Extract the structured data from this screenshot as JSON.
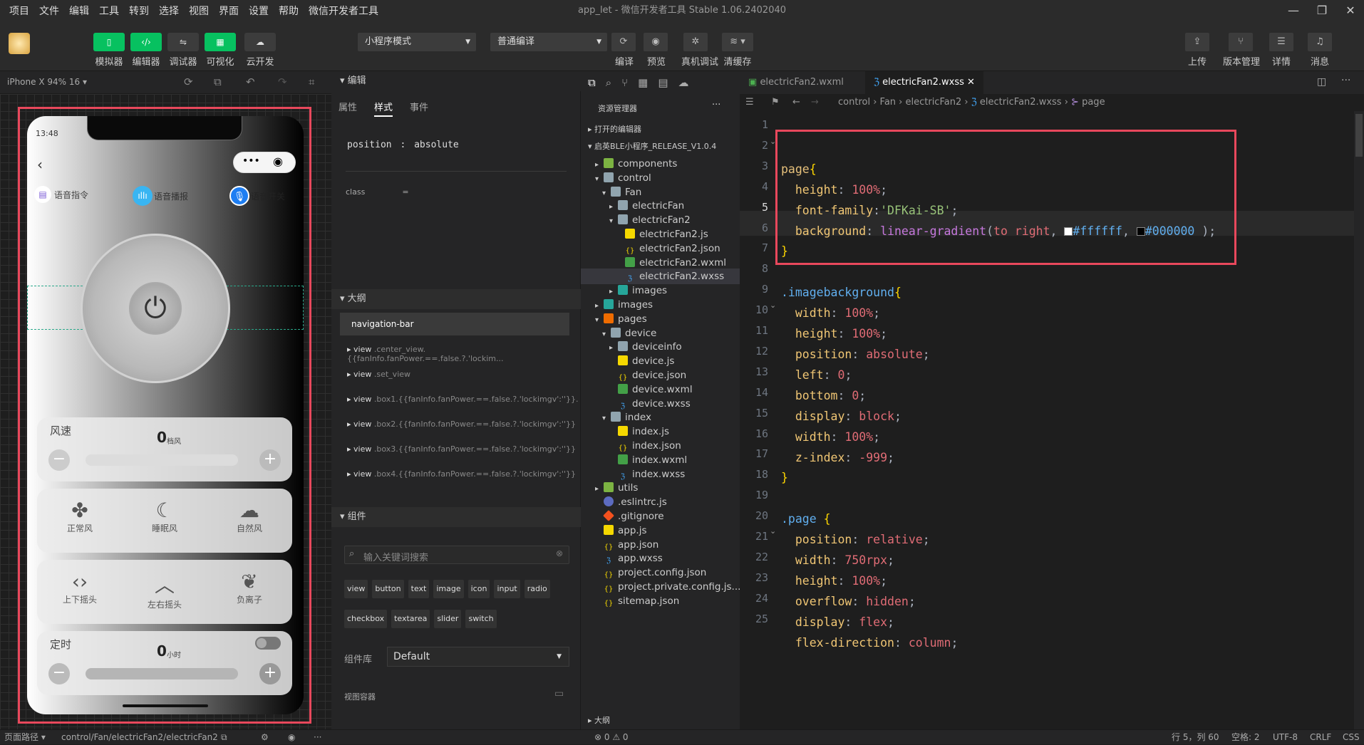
{
  "menu": [
    "项目",
    "文件",
    "编辑",
    "工具",
    "转到",
    "选择",
    "视图",
    "界面",
    "设置",
    "帮助",
    "微信开发者工具"
  ],
  "window_title": "app_let - 微信开发者工具 Stable 1.06.2402040",
  "toolbar": {
    "mode_buttons": [
      "模拟器",
      "编辑器",
      "调试器",
      "可视化",
      "云开发"
    ],
    "mode_select": "小程序模式",
    "compile_select": "普通编译",
    "action_labels": [
      "编译",
      "预览",
      "真机调试",
      "清缓存"
    ],
    "right_labels": [
      "上传",
      "版本管理",
      "详情",
      "消息"
    ]
  },
  "simulator": {
    "device": "iPhone X 94% 16",
    "time": "13:48",
    "voice_buttons": [
      "语音指令",
      "语音播报",
      "语音开关"
    ],
    "speed_label": "风速",
    "speed_value": "0",
    "speed_unit": "档风",
    "modes": [
      "正常风",
      "睡眠风",
      "自然风"
    ],
    "swings": [
      "上下摇头",
      "左右摇头",
      "负离子"
    ],
    "timer_label": "定时",
    "timer_value": "0",
    "timer_unit": "小时"
  },
  "attr_panel": {
    "title": "编辑",
    "tabs": [
      "属性",
      "样式",
      "事件"
    ],
    "position_label": "position",
    "position_sep": ":",
    "position_value": "absolute",
    "class_label": "class",
    "class_sep": "=",
    "outline_title": "大纲",
    "outline_selected": "navigation-bar",
    "outline_items": [
      {
        "tag": "view",
        "cls": ".center_view.{{fanInfo.fanPower.==.false.?.'lockim..."
      },
      {
        "tag": "view",
        "cls": ".set_view"
      },
      {
        "tag": "view",
        "cls": ".box1.{{fanInfo.fanPower.==.false.?.'lockimgv':''}}."
      },
      {
        "tag": "view",
        "cls": ".box2.{{fanInfo.fanPower.==.false.?.'lockimgv':''}}"
      },
      {
        "tag": "view",
        "cls": ".box3.{{fanInfo.fanPower.==.false.?.'lockimgv':''}}"
      },
      {
        "tag": "view",
        "cls": ".box4.{{fanInfo.fanPower.==.false.?.'lockimgv':''}}"
      }
    ],
    "components_title": "组件",
    "search_placeholder": "输入关键词搜索",
    "chips_row1": [
      "view",
      "button",
      "text",
      "image",
      "icon",
      "input",
      "radio"
    ],
    "chips_row2": [
      "checkbox",
      "textarea",
      "slider",
      "switch"
    ],
    "lib_label": "组件库",
    "lib_value": "Default",
    "container_label": "视图容器"
  },
  "explorer": {
    "title": "资源管理器",
    "open_editors": "打开的编辑器",
    "project": "启英BLE小程序_RELEASE_V1.0.4",
    "outline": "大纲",
    "files": [
      {
        "name": "components",
        "level": 1,
        "type": "folder-green",
        "arrow": "▸"
      },
      {
        "name": "control",
        "level": 1,
        "type": "folder",
        "arrow": "▾"
      },
      {
        "name": "Fan",
        "level": 2,
        "type": "folder",
        "arrow": "▾"
      },
      {
        "name": "electricFan",
        "level": 3,
        "type": "folder",
        "arrow": "▸"
      },
      {
        "name": "electricFan2",
        "level": 3,
        "type": "folder",
        "arrow": "▾"
      },
      {
        "name": "electricFan2.js",
        "level": 4,
        "type": "js",
        "arrow": ""
      },
      {
        "name": "electricFan2.json",
        "level": 4,
        "type": "json",
        "arrow": ""
      },
      {
        "name": "electricFan2.wxml",
        "level": 4,
        "type": "wxml",
        "arrow": ""
      },
      {
        "name": "electricFan2.wxss",
        "level": 4,
        "type": "wxss",
        "arrow": "",
        "selected": true
      },
      {
        "name": "images",
        "level": 3,
        "type": "folder-img",
        "arrow": "▸"
      },
      {
        "name": "images",
        "level": 1,
        "type": "folder-img",
        "arrow": "▸"
      },
      {
        "name": "pages",
        "level": 1,
        "type": "folder-red",
        "arrow": "▾"
      },
      {
        "name": "device",
        "level": 2,
        "type": "folder",
        "arrow": "▾"
      },
      {
        "name": "deviceinfo",
        "level": 3,
        "type": "folder",
        "arrow": "▸"
      },
      {
        "name": "device.js",
        "level": 3,
        "type": "js",
        "arrow": ""
      },
      {
        "name": "device.json",
        "level": 3,
        "type": "json",
        "arrow": ""
      },
      {
        "name": "device.wxml",
        "level": 3,
        "type": "wxml",
        "arrow": ""
      },
      {
        "name": "device.wxss",
        "level": 3,
        "type": "wxss",
        "arrow": ""
      },
      {
        "name": "index",
        "level": 2,
        "type": "folder",
        "arrow": "▾"
      },
      {
        "name": "index.js",
        "level": 3,
        "type": "js",
        "arrow": ""
      },
      {
        "name": "index.json",
        "level": 3,
        "type": "json",
        "arrow": ""
      },
      {
        "name": "index.wxml",
        "level": 3,
        "type": "wxml",
        "arrow": ""
      },
      {
        "name": "index.wxss",
        "level": 3,
        "type": "wxss",
        "arrow": ""
      },
      {
        "name": "utils",
        "level": 1,
        "type": "folder-green",
        "arrow": "▸"
      },
      {
        "name": ".eslintrc.js",
        "level": 1,
        "type": "eslint",
        "arrow": ""
      },
      {
        "name": ".gitignore",
        "level": 1,
        "type": "git",
        "arrow": ""
      },
      {
        "name": "app.js",
        "level": 1,
        "type": "js",
        "arrow": ""
      },
      {
        "name": "app.json",
        "level": 1,
        "type": "json",
        "arrow": ""
      },
      {
        "name": "app.wxss",
        "level": 1,
        "type": "wxss",
        "arrow": ""
      },
      {
        "name": "project.config.json",
        "level": 1,
        "type": "json",
        "arrow": ""
      },
      {
        "name": "project.private.config.js...",
        "level": 1,
        "type": "json",
        "arrow": ""
      },
      {
        "name": "sitemap.json",
        "level": 1,
        "type": "json",
        "arrow": ""
      }
    ]
  },
  "editor": {
    "tabs": [
      "electricFan2.wxml",
      "electricFan2.wxss"
    ],
    "breadcrumb": [
      "control",
      "Fan",
      "electricFan2",
      "electricFan2.wxss",
      "page"
    ],
    "line_numbers": [
      "1",
      "2",
      "3",
      "4",
      "5",
      "6",
      "7",
      "8",
      "9",
      "10",
      "11",
      "12",
      "13",
      "14",
      "15",
      "16",
      "17",
      "18",
      "19",
      "20",
      "21",
      "22",
      "23",
      "24",
      "25"
    ]
  },
  "status": {
    "page_path_label": "页面路径",
    "page_path": "control/Fan/electricFan2/electricFan2",
    "errors": "0",
    "warnings": "0",
    "cursor": "行 5，列 60",
    "spaces": "空格: 2",
    "encoding": "UTF-8",
    "eol": "CRLF",
    "lang": "CSS"
  },
  "colors": {
    "accent_green": "#07c160",
    "highlight_red": "#e8485c"
  }
}
